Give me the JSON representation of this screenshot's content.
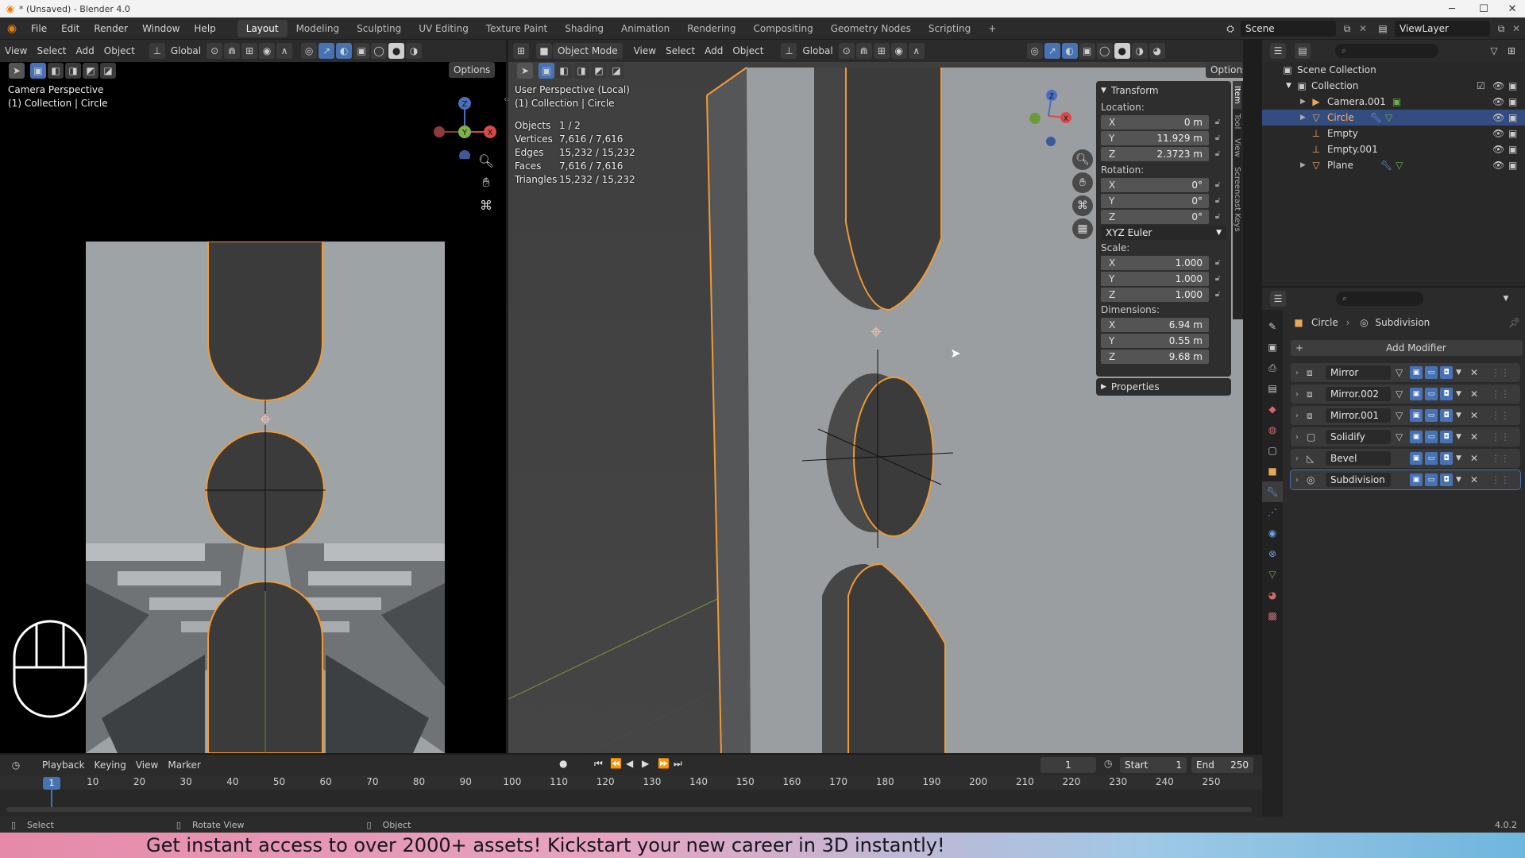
{
  "window": {
    "title": "* (Unsaved) - Blender 4.0"
  },
  "menu": {
    "file": "File",
    "edit": "Edit",
    "render": "Render",
    "window": "Window",
    "help": "Help"
  },
  "workspaces": [
    "Layout",
    "Modeling",
    "Sculpting",
    "UV Editing",
    "Texture Paint",
    "Shading",
    "Animation",
    "Rendering",
    "Compositing",
    "Geometry Nodes",
    "Scripting"
  ],
  "scene": {
    "name": "Scene",
    "view_layer": "ViewLayer"
  },
  "left_view": {
    "menus": {
      "view": "View",
      "select": "Select",
      "add": "Add",
      "object": "Object"
    },
    "orientation": "Global",
    "options": "Options",
    "title": "Camera Perspective",
    "subtitle": "(1) Collection | Circle"
  },
  "main_view": {
    "mode": "Object Mode",
    "menus": {
      "view": "View",
      "select": "Select",
      "add": "Add",
      "object": "Object"
    },
    "orientation": "Global",
    "options": "Options",
    "title": "User Perspective (Local)",
    "subtitle": "(1) Collection | Circle",
    "stats": [
      {
        "label": "Objects",
        "value": "1 / 2"
      },
      {
        "label": "Vertices",
        "value": "7,616 / 7,616"
      },
      {
        "label": "Edges",
        "value": "15,232 / 15,232"
      },
      {
        "label": "Faces",
        "value": "7,616 / 7,616"
      },
      {
        "label": "Triangles",
        "value": "15,232 / 15,232"
      }
    ]
  },
  "transform": {
    "header": "Transform",
    "location_label": "Location:",
    "location": [
      {
        "axis": "X",
        "value": "0 m"
      },
      {
        "axis": "Y",
        "value": "11.929 m"
      },
      {
        "axis": "Z",
        "value": "2.3723 m"
      }
    ],
    "rotation_label": "Rotation:",
    "rotation": [
      {
        "axis": "X",
        "value": "0°"
      },
      {
        "axis": "Y",
        "value": "0°"
      },
      {
        "axis": "Z",
        "value": "0°"
      }
    ],
    "rotation_mode": "XYZ Euler",
    "scale_label": "Scale:",
    "scale": [
      {
        "axis": "X",
        "value": "1.000"
      },
      {
        "axis": "Y",
        "value": "1.000"
      },
      {
        "axis": "Z",
        "value": "1.000"
      }
    ],
    "dimensions_label": "Dimensions:",
    "dimensions": [
      {
        "axis": "X",
        "value": "6.94 m"
      },
      {
        "axis": "Y",
        "value": "0.55 m"
      },
      {
        "axis": "Z",
        "value": "9.68 m"
      }
    ],
    "properties": "Properties"
  },
  "sidebar_tabs": [
    "Item",
    "Tool",
    "View",
    "Screencast Keys"
  ],
  "outliner": {
    "root": "Scene Collection",
    "collection": "Collection",
    "items": [
      {
        "name": "Camera.001",
        "selected": false
      },
      {
        "name": "Circle",
        "selected": true
      },
      {
        "name": "Empty",
        "selected": false
      },
      {
        "name": "Empty.001",
        "selected": false
      },
      {
        "name": "Plane",
        "selected": false
      }
    ]
  },
  "properties": {
    "object": "Circle",
    "modifier_context": "Subdivision",
    "add_modifier": "Add Modifier",
    "modifiers": [
      "Mirror",
      "Mirror.002",
      "Mirror.001",
      "Solidify",
      "Bevel",
      "Subdivision"
    ]
  },
  "timeline": {
    "menus": {
      "playback": "Playback",
      "keying": "Keying",
      "view": "View",
      "marker": "Marker"
    },
    "current_frame": "1",
    "start_label": "Start",
    "start": "1",
    "end_label": "End",
    "end": "250",
    "ticks": [
      "1",
      "10",
      "20",
      "30",
      "40",
      "50",
      "60",
      "70",
      "80",
      "90",
      "100",
      "110",
      "120",
      "130",
      "140",
      "150",
      "160",
      "170",
      "180",
      "190",
      "200",
      "210",
      "220",
      "230",
      "240",
      "250"
    ]
  },
  "status": {
    "select": "Select",
    "rotate": "Rotate View",
    "object": "Object",
    "version": "4.0.2"
  },
  "banner": {
    "text": "Get instant access to over 2000+ assets! Kickstart your new career in 3D instantly!"
  },
  "colors": {
    "selection_orange": "#f29a35",
    "accent_blue": "#4772b3"
  }
}
